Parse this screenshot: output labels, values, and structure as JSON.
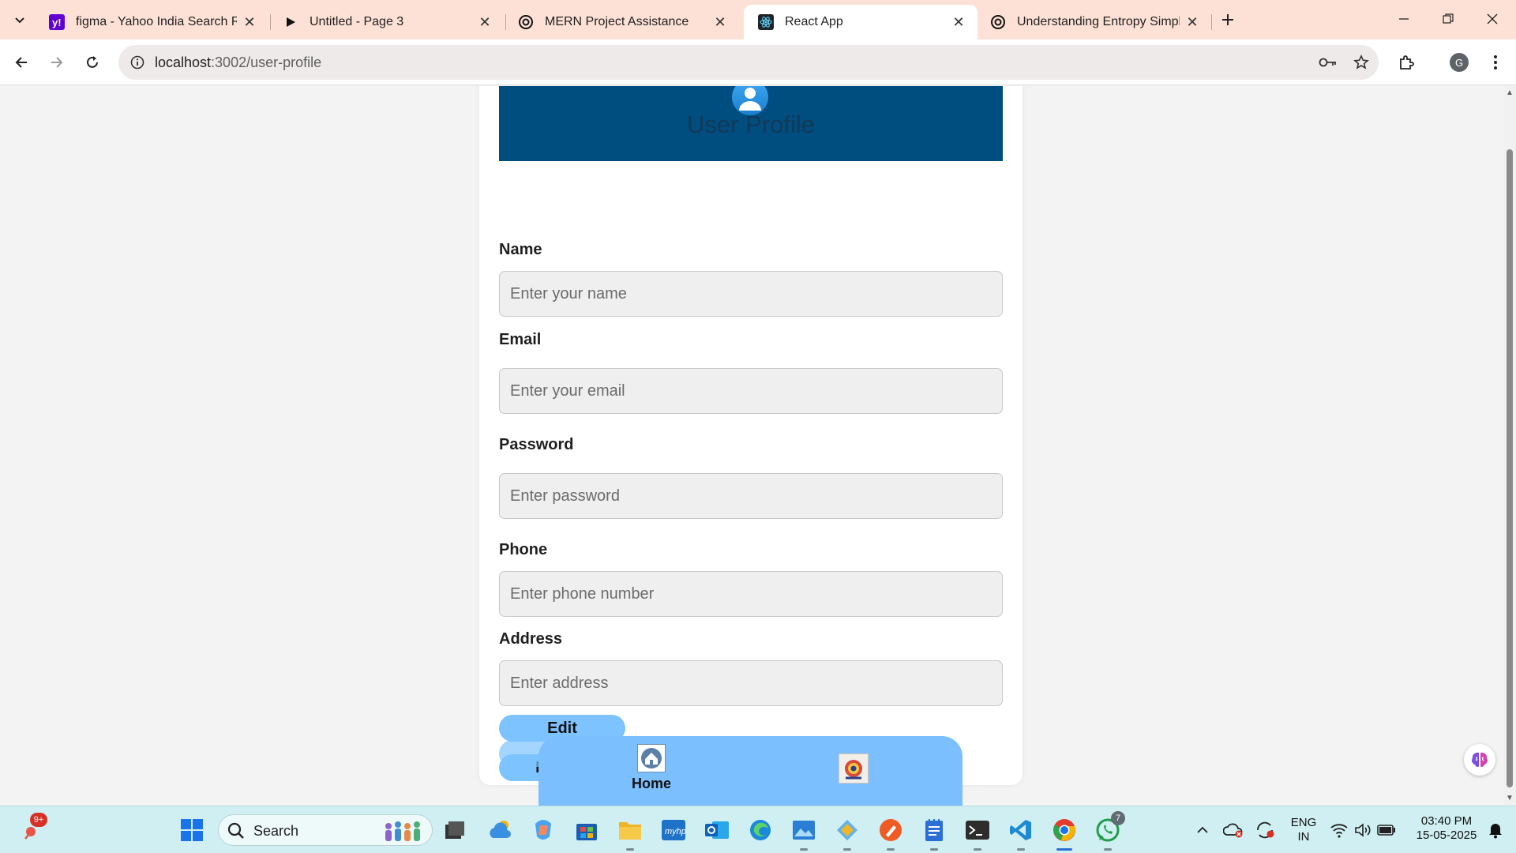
{
  "browser": {
    "tabs": [
      {
        "title": "figma - Yahoo India Search Resu",
        "favicon": "yahoo-icon",
        "active": false
      },
      {
        "title": "Untitled - Page 3",
        "favicon": "play-icon",
        "active": false
      },
      {
        "title": "MERN Project Assistance",
        "favicon": "openai-icon",
        "active": false
      },
      {
        "title": "React App",
        "favicon": "react-icon",
        "active": true
      },
      {
        "title": "Understanding Entropy Simply",
        "favicon": "openai-icon",
        "active": false
      }
    ],
    "url_host": "localhost",
    "url_path": ":3002/user-profile",
    "profile_initial": "G"
  },
  "page": {
    "title": "User Profile",
    "fields": [
      {
        "label": "Name",
        "placeholder": "Enter your name"
      },
      {
        "label": "Email",
        "placeholder": "Enter your email"
      },
      {
        "label": "Password",
        "placeholder": "Enter password"
      },
      {
        "label": "Phone",
        "placeholder": "Enter phone number"
      },
      {
        "label": "Address",
        "placeholder": "Enter address"
      }
    ],
    "edit_label": "Edit",
    "logout_label": "Logout",
    "bottom_nav": {
      "home_label": "Home"
    }
  },
  "taskbar": {
    "notification_count": "9+",
    "search_text": "Search",
    "whatsapp_badge": "7",
    "language": "ENG",
    "region": "IN",
    "time": "03:40 PM",
    "date": "15-05-2025"
  },
  "colors": {
    "banner": "#004d80",
    "button": "#7cc3ff",
    "bottom_nav": "#7cbfff",
    "tabstrip": "#fde1d6",
    "taskbar": "#cfeff2"
  }
}
